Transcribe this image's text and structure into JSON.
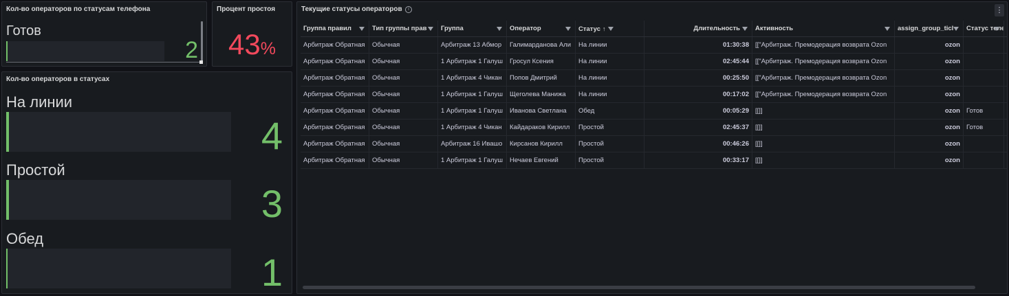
{
  "phone_panel": {
    "title": "Кол-во операторов по статусам телефона",
    "label": "Готов",
    "value": "2",
    "fill_fraction": 0.01
  },
  "idle_panel": {
    "title": "Процент простоя",
    "value": "43",
    "unit": "%"
  },
  "status_panel": {
    "title": "Кол-во операторов в статусах",
    "rows": [
      {
        "label": "На линии",
        "value": "4"
      },
      {
        "label": "Простой",
        "value": "3"
      },
      {
        "label": "Обед",
        "value": "1"
      }
    ]
  },
  "table_panel": {
    "title": "Текущие статусы операторов",
    "info_icon": "info-icon",
    "menu_icon": "kebab-menu-icon",
    "columns": [
      "Группа правил",
      "Тип группы прав",
      "Группа",
      "Оператор",
      "Статус",
      "Длительность",
      "Активность",
      "assign_group_ticl",
      "Статус теле"
    ],
    "sort_icon": "↑",
    "rows": [
      [
        "Арбитраж Обратная",
        "Обычная",
        "Арбитраж 13 Абмор",
        "Галимарданова Али",
        "На линии",
        "01:30:38",
        "[[\"Арбитраж. Премодерация возврата Ozon",
        "ozon",
        ""
      ],
      [
        "Арбитраж Обратная",
        "Обычная",
        "1 Арбитраж 1 Галуш",
        "Гросул Ксения",
        "На линии",
        "02:45:44",
        "[[\"Арбитраж. Премодерация возврата Ozon",
        "ozon",
        ""
      ],
      [
        "Арбитраж Обратная",
        "Обычная",
        "1 Арбитраж 4 Чикан",
        "Попов Дмитрий",
        "На линии",
        "00:25:50",
        "[[\"Арбитраж. Премодерация возврата Ozon",
        "ozon",
        ""
      ],
      [
        "Арбитраж Обратная",
        "Обычная",
        "1 Арбитраж 1 Галуш",
        "Щеголева Манижа",
        "На линии",
        "00:17:02",
        "[[\"Арбитраж. Премодерация возврата Ozon",
        "ozon",
        ""
      ],
      [
        "Арбитраж Обратная",
        "Обычная",
        "1 Арбитраж 1 Галуш",
        "Иванова Светлана",
        "Обед",
        "00:05:29",
        "[[]]",
        "ozon",
        "Готов"
      ],
      [
        "Арбитраж Обратная",
        "Обычная",
        "1 Арбитраж 4 Чикан",
        "Кайдараков Кирилл",
        "Простой",
        "02:45:37",
        "[[]]",
        "ozon",
        "Готов"
      ],
      [
        "Арбитраж Обратная",
        "Обычная",
        "Арбитраж 16 Ивашо",
        "Кирсанов Кирилл",
        "Простой",
        "00:46:26",
        "[[]]",
        "ozon",
        ""
      ],
      [
        "Арбитраж Обратная",
        "Обычная",
        "1 Арбитраж 1 Галуш",
        "Нечаев Евгений",
        "Простой",
        "00:33:17",
        "[[]]",
        "ozon",
        ""
      ]
    ]
  },
  "colors": {
    "background": "#111217",
    "panel": "#181b1f",
    "green": "#73bf69",
    "red": "#f2495c"
  }
}
